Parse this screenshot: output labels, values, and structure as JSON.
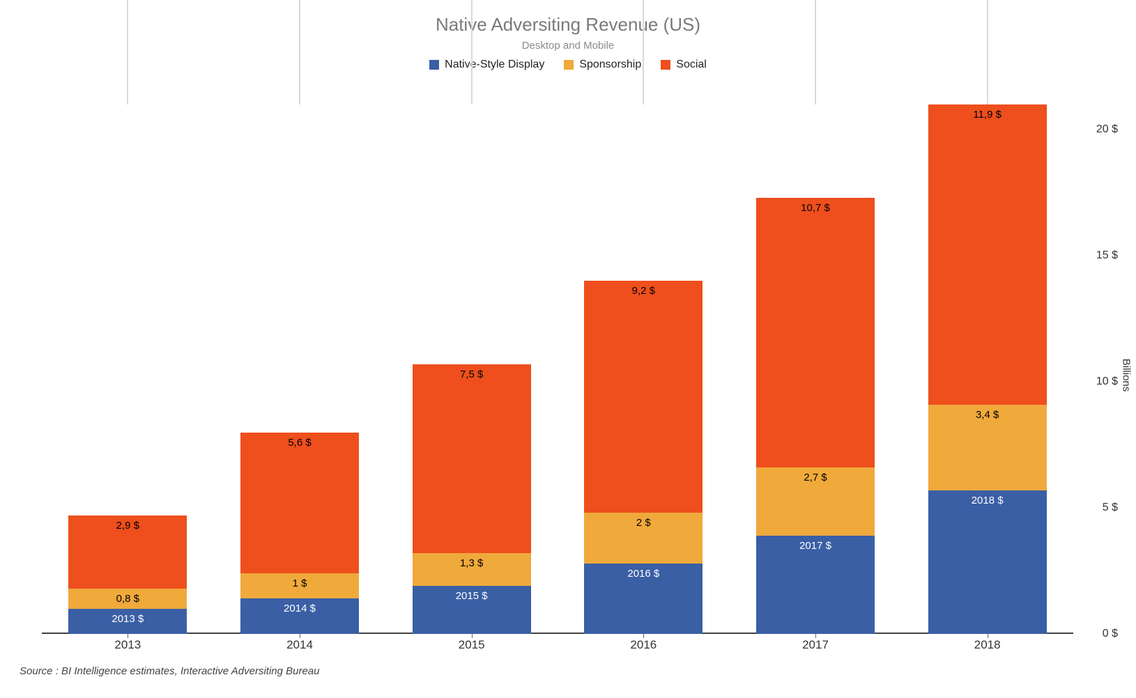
{
  "title": "Native Adversiting Revenue (US)",
  "subtitle": "Desktop and Mobile",
  "legend": [
    {
      "label": "Native-Style Display",
      "color": "#3a5fa5"
    },
    {
      "label": "Sponsorship",
      "color": "#f0a93b"
    },
    {
      "label": "Social",
      "color": "#ee4f1d"
    }
  ],
  "source": "Source : BI Intelligence estimates, Interactive Adversiting Bureau",
  "yaxis_title": "Billions",
  "yaxis_ticks": [
    "0 $",
    "5 $",
    "10 $",
    "15 $",
    "20 $"
  ],
  "chart_data": {
    "type": "bar",
    "stacked": true,
    "ymax": 21,
    "categories": [
      "2013",
      "2014",
      "2015",
      "2016",
      "2017",
      "2018"
    ],
    "series": [
      {
        "name": "Native-Style Display",
        "values": [
          1.0,
          1.4,
          1.9,
          2.8,
          3.9,
          5.7
        ],
        "labels": [
          "2013 $",
          "2014 $",
          "2015 $",
          "2016 $",
          "2017 $",
          "2018 $"
        ]
      },
      {
        "name": "Sponsorship",
        "values": [
          0.8,
          1.0,
          1.3,
          2.0,
          2.7,
          3.4
        ],
        "labels": [
          "0,8 $",
          "1 $",
          "1,3 $",
          "2 $",
          "2,7 $",
          "3,4 $"
        ]
      },
      {
        "name": "Social",
        "values": [
          2.9,
          5.6,
          7.5,
          9.2,
          10.7,
          11.9
        ],
        "labels": [
          "2,9 $",
          "5,6 $",
          "7,5 $",
          "9,2 $",
          "10,7 $",
          "11,9 $"
        ]
      }
    ],
    "title": "Native Adversiting Revenue (US)",
    "subtitle": "Desktop and Mobile",
    "xlabel": "",
    "ylabel": "Billions",
    "ylim": [
      0,
      21
    ]
  }
}
